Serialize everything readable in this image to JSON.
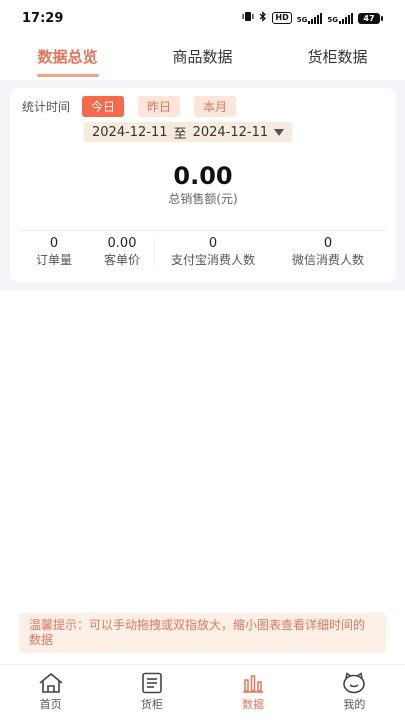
{
  "status_bar": {
    "time": "17:29",
    "network1": "5G",
    "network2": "5G",
    "hd": "HD",
    "battery": "47"
  },
  "tabs": [
    {
      "label": "数据总览",
      "active": true
    },
    {
      "label": "商品数据",
      "active": false
    },
    {
      "label": "货柜数据",
      "active": false
    }
  ],
  "stats": {
    "label": "统计时间",
    "chips": [
      {
        "label": "今日",
        "active": true
      },
      {
        "label": "昨日"
      },
      {
        "label": "本月"
      }
    ],
    "start_date": "2024-12-11",
    "to": "至",
    "end_date": "2024-12-11"
  },
  "total": {
    "value": "0.00",
    "label": "总销售额(元)"
  },
  "metrics": [
    {
      "value": "0",
      "label": "订单量"
    },
    {
      "value": "0.00",
      "label": "客单价"
    },
    {
      "value": "0",
      "label": "支付宝消费人数"
    },
    {
      "value": "0",
      "label": "微信消费人数"
    }
  ],
  "tip": "温馨提示：可以手动拖拽或双指放大，缩小图表查看详细时间的数据",
  "bottom_nav": [
    {
      "label": "首页",
      "icon": "home-icon"
    },
    {
      "label": "货柜",
      "icon": "cabinet-icon"
    },
    {
      "label": "数据",
      "icon": "chart-icon",
      "active": true
    },
    {
      "label": "我的",
      "icon": "profile-icon"
    }
  ],
  "colors": {
    "accent": "#e8735a",
    "chip_active": "#f56a4a",
    "chip_bg": "#fbe6d9",
    "page_bg": "#f4f5f9"
  }
}
